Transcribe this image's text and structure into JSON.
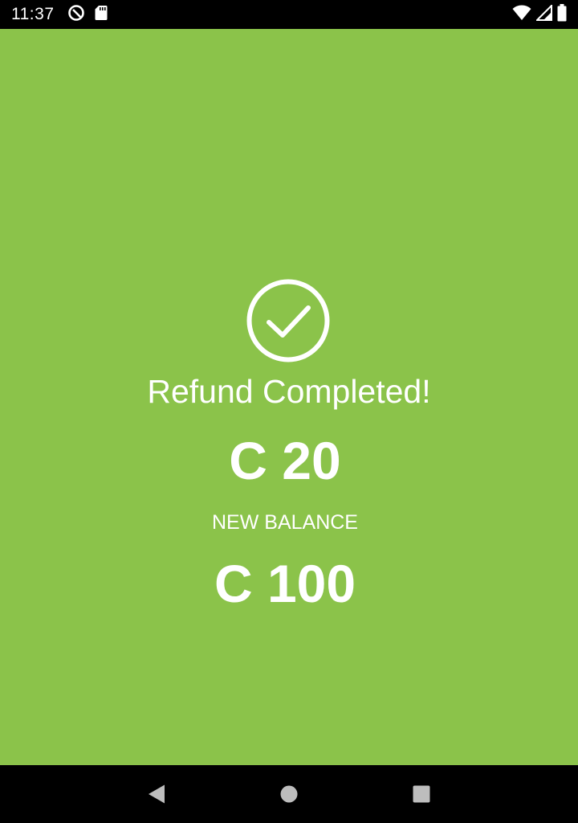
{
  "status_bar": {
    "time": "11:37",
    "icons": [
      "no-disturb-icon",
      "sd-card-icon",
      "wifi-icon",
      "signal-icon",
      "battery-icon"
    ]
  },
  "screen": {
    "background_color": "#8bc34a",
    "icon": "check-circle-icon",
    "title": "Refund Completed!",
    "refund_amount": "C 20",
    "balance_label": "NEW BALANCE",
    "balance_amount": "C 100"
  },
  "nav_bar": {
    "buttons": [
      "back-icon",
      "home-icon",
      "recents-icon"
    ]
  }
}
